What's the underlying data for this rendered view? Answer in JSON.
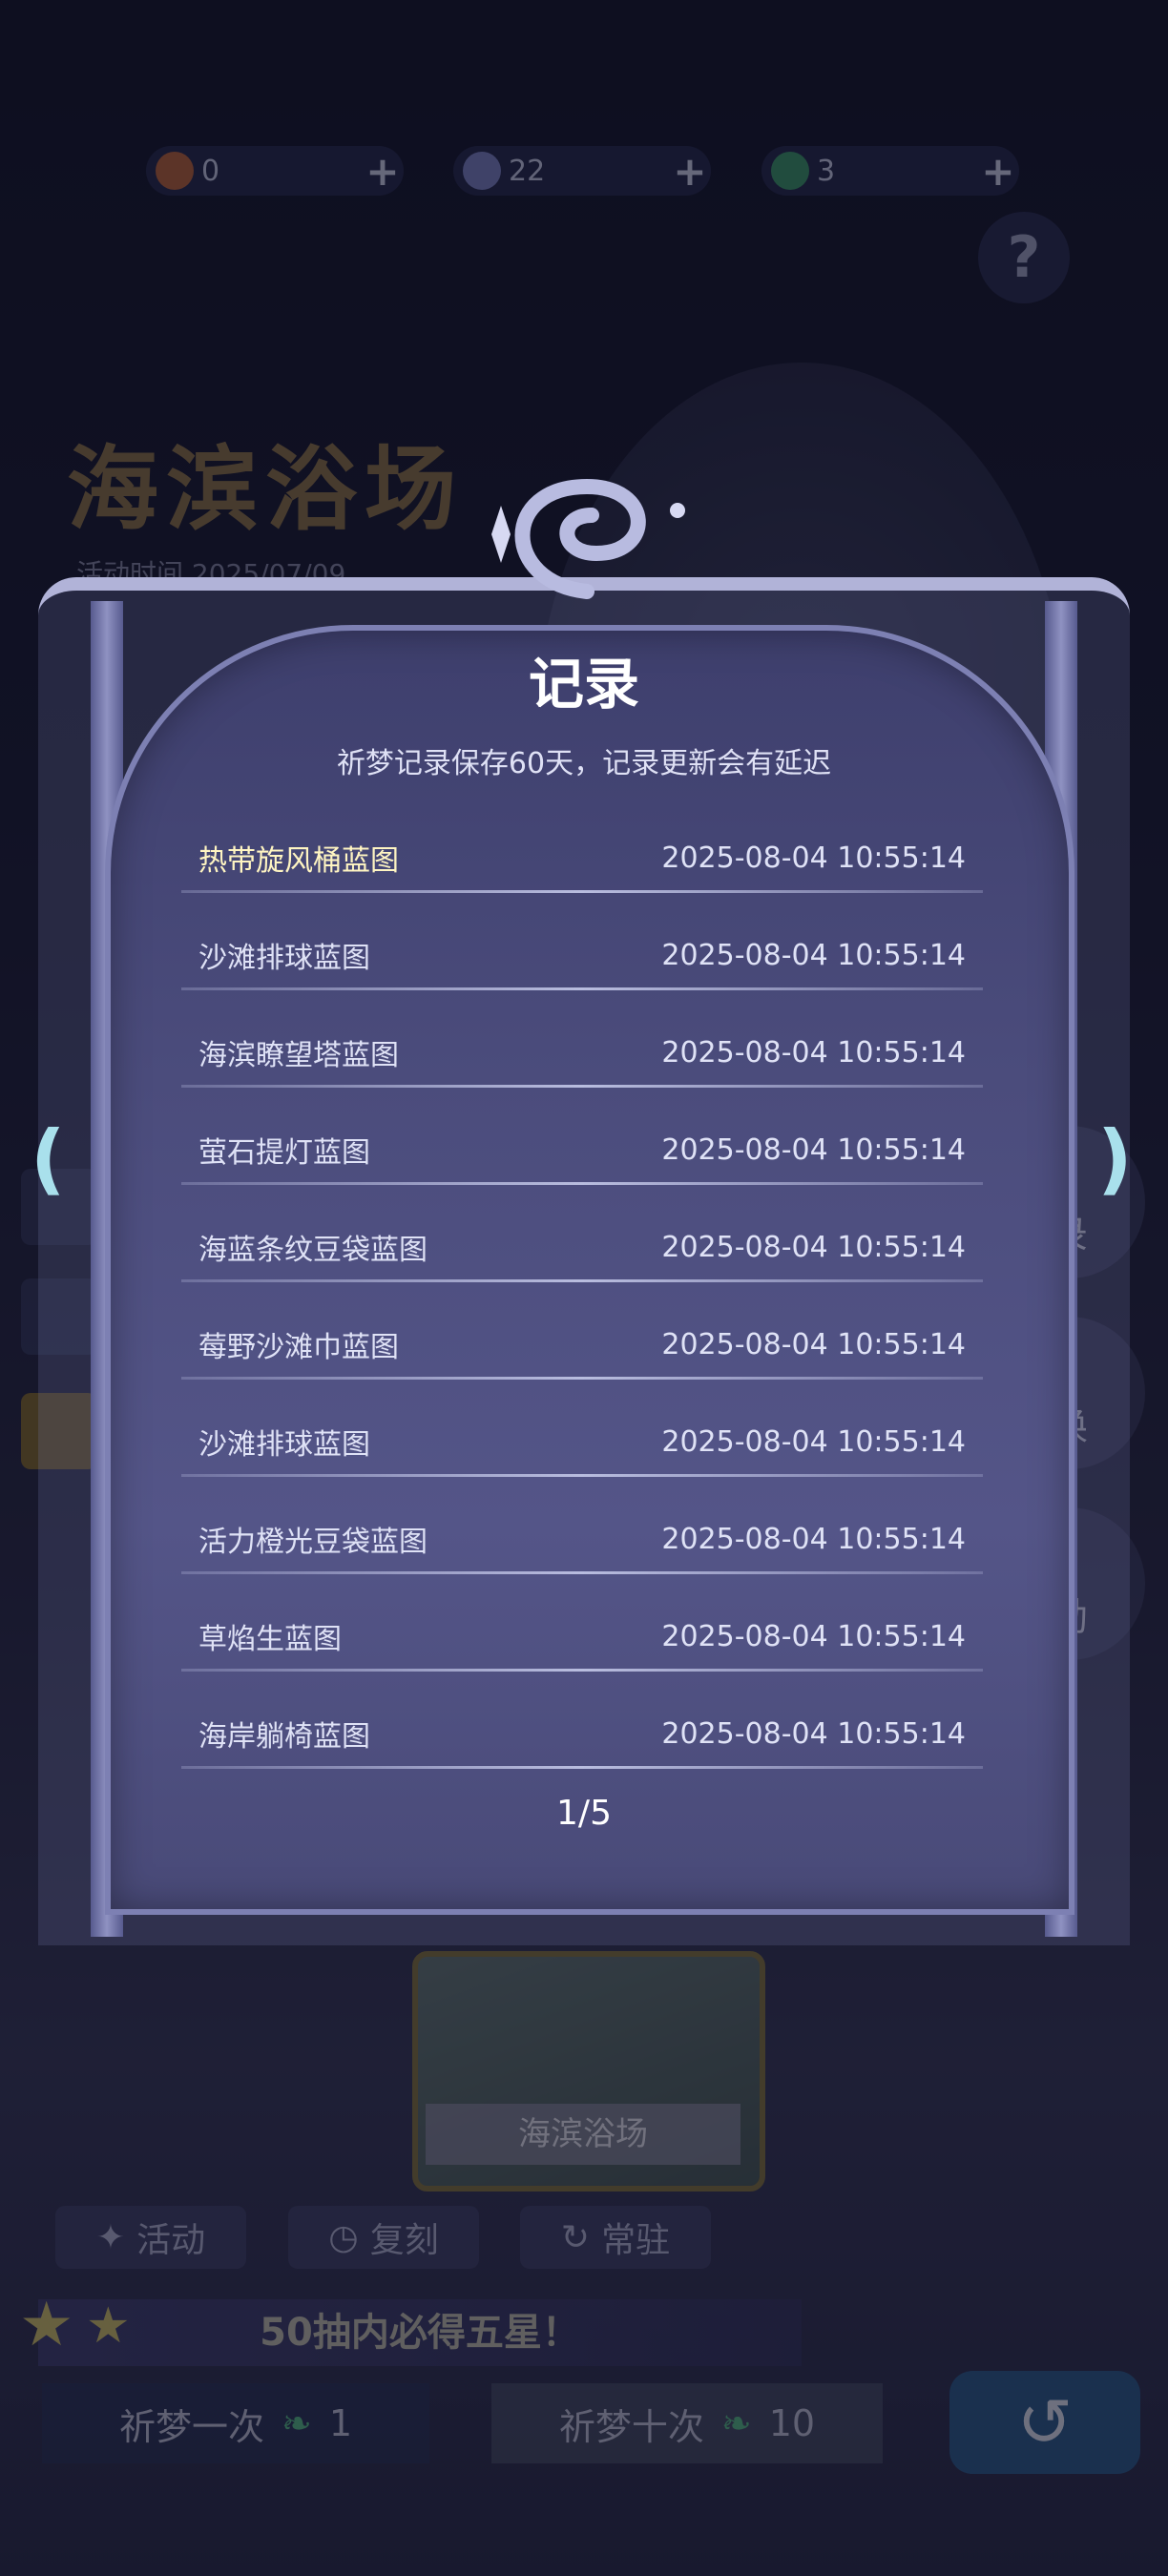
{
  "currency": [
    {
      "icon": "sun-coin-icon",
      "value": "0"
    },
    {
      "icon": "moon-coin-icon",
      "value": "22"
    },
    {
      "icon": "feather-icon",
      "value": "3"
    }
  ],
  "banner": {
    "title": "海滨浴场",
    "time": "活动时间 2025/07/09"
  },
  "modal": {
    "title": "记录",
    "subtitle": "祈梦记录保存60天，记录更新会有延迟",
    "records": [
      {
        "name": "热带旋风桶蓝图",
        "time": "2025-08-04 10:55:14"
      },
      {
        "name": "沙滩排球蓝图",
        "time": "2025-08-04 10:55:14"
      },
      {
        "name": "海滨瞭望塔蓝图",
        "time": "2025-08-04 10:55:14"
      },
      {
        "name": "萤石提灯蓝图",
        "time": "2025-08-04 10:55:14"
      },
      {
        "name": "海蓝条纹豆袋蓝图",
        "time": "2025-08-04 10:55:14"
      },
      {
        "name": "莓野沙滩巾蓝图",
        "time": "2025-08-04 10:55:14"
      },
      {
        "name": "沙滩排球蓝图",
        "time": "2025-08-04 10:55:14"
      },
      {
        "name": "活力橙光豆袋蓝图",
        "time": "2025-08-04 10:55:14"
      },
      {
        "name": "草焰生蓝图",
        "time": "2025-08-04 10:55:14"
      },
      {
        "name": "海岸躺椅蓝图",
        "time": "2025-08-04 10:55:14"
      }
    ],
    "page": "1/5"
  },
  "right_side": [
    "录",
    "换",
    "励"
  ],
  "bottom": {
    "thumb_label": "海滨浴场",
    "tabs": [
      "活动",
      "复刻",
      "常驻"
    ],
    "guarantee": "50抽内必得五星！",
    "draw_one": {
      "label": "祈梦一次",
      "cost": "1"
    },
    "draw_ten": {
      "label": "祈梦十次",
      "cost": "10"
    }
  }
}
